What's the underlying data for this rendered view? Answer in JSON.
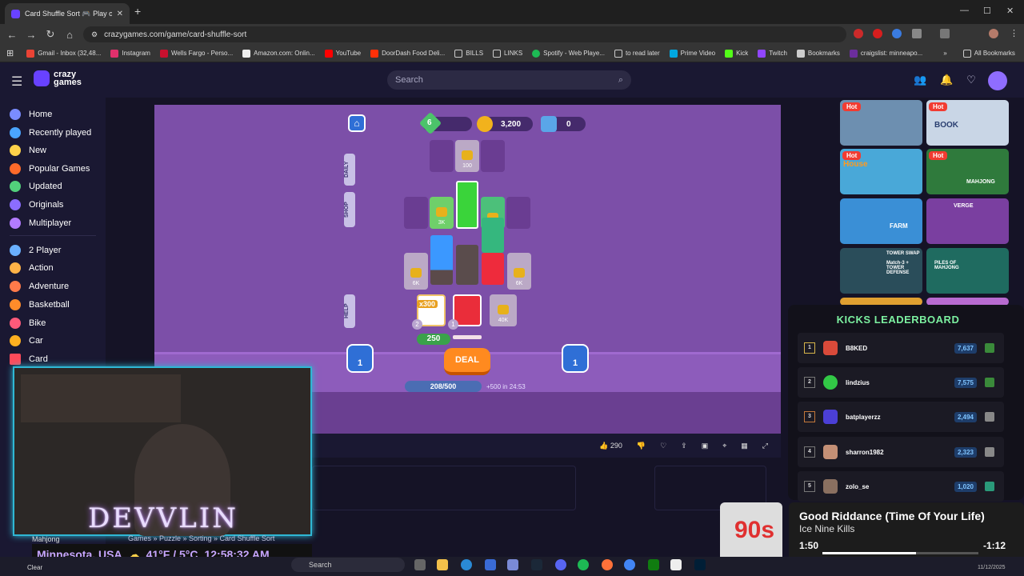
{
  "browser": {
    "tab_title": "Card Shuffle Sort 🎮 Play on C",
    "url": "crazygames.com/game/card-shuffle-sort",
    "bookmarks": [
      "Gmail - Inbox (32,48...",
      "Instagram",
      "Wells Fargo - Perso...",
      "Amazon.com: Onlin...",
      "YouTube",
      "DoorDash Food Deli...",
      "BILLS",
      "LINKS",
      "Spotify - Web Playe...",
      "to read later",
      "Prime Video",
      "Kick",
      "Twitch",
      "Bookmarks",
      "craigslist: minneapo..."
    ],
    "all_bookmarks": "All Bookmarks"
  },
  "site": {
    "logo_line1": "crazy",
    "logo_line2": "games",
    "search_placeholder": "Search",
    "sidebar": [
      "Home",
      "Recently played",
      "New",
      "Popular Games",
      "Updated",
      "Originals",
      "Multiplayer",
      "2 Player",
      "Action",
      "Adventure",
      "Basketball",
      "Bike",
      "Car",
      "Card"
    ]
  },
  "game": {
    "level": "6",
    "coins": "3,200",
    "gems": "0",
    "tabs": [
      "DAILY",
      "SHOP",
      "HELP"
    ],
    "lock_top": "100",
    "lock_3k": "3K",
    "lock_6k": "6K",
    "lock_40k": "40K",
    "multiplier": "x300",
    "count_left": "2",
    "count_right": "1",
    "bonus": "250",
    "left_btn": "1",
    "right_btn": "1",
    "deal": "DEAL",
    "energy": "208/500",
    "energy_timer": "+500 in 24:53",
    "likes": "290"
  },
  "thumb_badge": "Hot",
  "thumbs": [
    {
      "hot": true,
      "color": "#6d8fb0"
    },
    {
      "hot": true,
      "color": "#c9d6e6"
    },
    {
      "hot": true,
      "color": "#49a8d8"
    },
    {
      "hot": true,
      "color": "#2f7a3c"
    },
    {
      "hot": false,
      "color": "#3a8fd6"
    },
    {
      "hot": false,
      "color": "#7a3fa0"
    },
    {
      "hot": false,
      "color": "#2a4d5a"
    },
    {
      "hot": false,
      "color": "#1f6b60"
    }
  ],
  "thumb_texts": {
    "farm": "FARM",
    "verge": "VERGE",
    "tower": "TOWER SWAP",
    "match": "Match-3 + TOWER DEFENSE",
    "piles": "PILES OF MAHJONG",
    "book": "BOOK",
    "house": "House",
    "mahjong": "MAHJONG"
  },
  "leaderboard": {
    "title": "KICKS LEADERBOARD",
    "rows": [
      {
        "rank": "1",
        "name": "B8KED",
        "points": "7,637"
      },
      {
        "rank": "2",
        "name": "lindzius",
        "points": "7,575"
      },
      {
        "rank": "3",
        "name": "batplayerzz",
        "points": "2,494"
      },
      {
        "rank": "4",
        "name": "sharron1982",
        "points": "2,323"
      },
      {
        "rank": "5",
        "name": "zolo_se",
        "points": "1,020"
      }
    ]
  },
  "stream": {
    "name": "DEVVLIN",
    "location": "Minnesota, USA",
    "temp": "41°F / 5°C",
    "time": "12:58:32 AM",
    "breadcrumb": "Games » Puzzle » Sorting » Card Shuffle Sort",
    "bottom_label": "Mahjong"
  },
  "music": {
    "title": "Good Riddance (Time Of Your Life)",
    "artist": "Ice Nine Kills",
    "elapsed": "1:50",
    "remaining": "-1:12",
    "progress": 0.6,
    "album_label": "90s"
  },
  "taskbar": {
    "search": "Search",
    "weather": "Clear",
    "date": "11/12/2025"
  }
}
